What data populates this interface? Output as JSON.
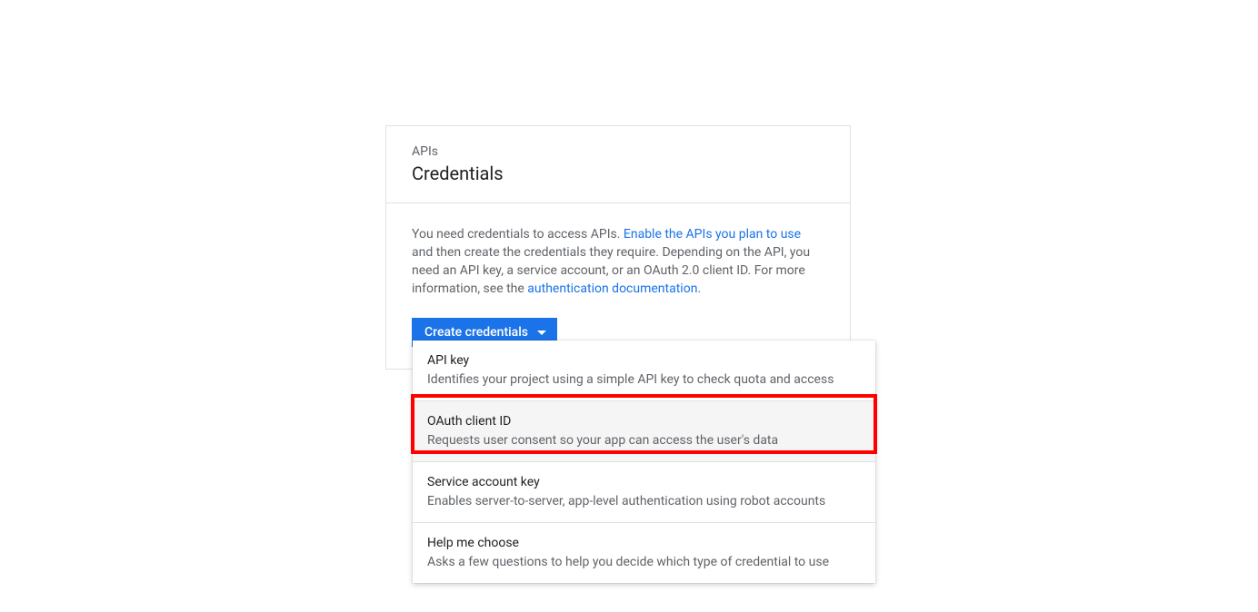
{
  "panel": {
    "overline": "APIs",
    "title": "Credentials",
    "text_parts": {
      "p1": "You need credentials to access APIs. ",
      "link1": "Enable the APIs you plan to use",
      "p2": " and then create the credentials they require. Depending on the API, you need an API key, a service account, or an OAuth 2.0 client ID. For more information, see the ",
      "link2": "authentication documentation",
      "p3": "."
    },
    "create_button": "Create credentials"
  },
  "dropdown": {
    "items": [
      {
        "title": "API key",
        "desc": "Identifies your project using a simple API key to check quota and access"
      },
      {
        "title": "OAuth client ID",
        "desc": "Requests user consent so your app can access the user's data"
      },
      {
        "title": "Service account key",
        "desc": "Enables server-to-server, app-level authentication using robot accounts"
      },
      {
        "title": "Help me choose",
        "desc": "Asks a few questions to help you decide which type of credential to use"
      }
    ]
  }
}
